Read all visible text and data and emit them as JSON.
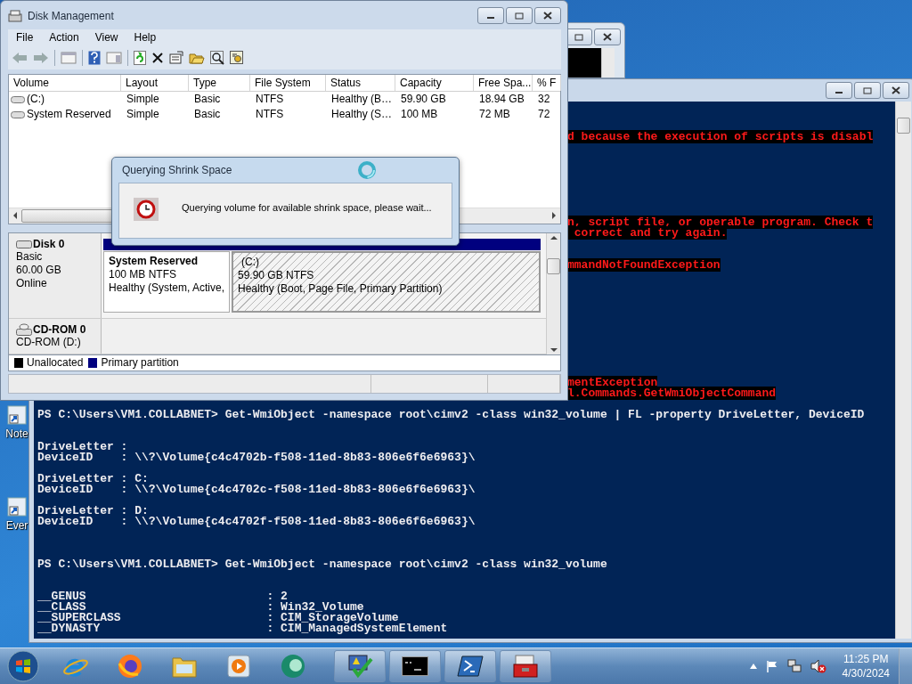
{
  "desktop_icons": [
    {
      "label": "Note"
    },
    {
      "label": "Ever"
    }
  ],
  "console": {
    "blocks": [
      {
        "kind": "error",
        "lines": [
          "d because the execution of scripts is disabl"
        ]
      },
      {
        "kind": "error",
        "lines": [
          "n, script file, or operable program. Check t",
          " correct and try again."
        ]
      },
      {
        "kind": "error",
        "lines": [
          "mmandNotFoundException"
        ]
      },
      {
        "kind": "error",
        "lines": [
          "mentException",
          "l.Commands.GetWmiObjectCommand"
        ]
      },
      {
        "kind": "output",
        "lines": [
          "PS C:\\Users\\VM1.COLLABNET> Get-WmiObject -namespace root\\cimv2 -class win32_volume | FL -property DriveLetter, DeviceID"
        ]
      },
      {
        "kind": "output",
        "lines": [
          "DriveLetter :",
          "DeviceID    : \\\\?\\Volume{c4c4702b-f508-11ed-8b83-806e6f6e6963}\\"
        ]
      },
      {
        "kind": "output",
        "lines": [
          "DriveLetter : C:",
          "DeviceID    : \\\\?\\Volume{c4c4702c-f508-11ed-8b83-806e6f6e6963}\\"
        ]
      },
      {
        "kind": "output",
        "lines": [
          "DriveLetter : D:",
          "DeviceID    : \\\\?\\Volume{c4c4702f-f508-11ed-8b83-806e6f6e6963}\\"
        ]
      },
      {
        "kind": "output",
        "lines": [
          "PS C:\\Users\\VM1.COLLABNET> Get-WmiObject -namespace root\\cimv2 -class win32_volume"
        ]
      },
      {
        "kind": "output",
        "lines": [
          "__GENUS                          : 2",
          "__CLASS                          : Win32_Volume",
          "__SUPERCLASS                     : CIM_StorageVolume",
          "__DYNASTY                        : CIM_ManagedSystemElement"
        ]
      }
    ]
  },
  "disk_management": {
    "title": "Disk Management",
    "menu": [
      "File",
      "Action",
      "View",
      "Help"
    ],
    "columns": [
      "Volume",
      "Layout",
      "Type",
      "File System",
      "Status",
      "Capacity",
      "Free Spa...",
      "% F"
    ],
    "rows": [
      [
        "(C:)",
        "Simple",
        "Basic",
        "NTFS",
        "Healthy (B…",
        "59.90 GB",
        "18.94 GB",
        "32"
      ],
      [
        "System Reserved",
        "Simple",
        "Basic",
        "NTFS",
        "Healthy (S…",
        "100 MB",
        "72 MB",
        "72"
      ]
    ],
    "disks": [
      {
        "kind": "disk",
        "name": "Disk 0",
        "lines": [
          "Basic",
          "60.00 GB",
          "Online"
        ],
        "partitions": [
          {
            "name": "System Reserved",
            "size": "100 MB NTFS",
            "status": "Healthy (System, Active,",
            "selected": false
          },
          {
            "name": "(C:)",
            "size": "59.90 GB NTFS",
            "status": "Healthy (Boot, Page File, Primary Partition)",
            "selected": true
          }
        ]
      },
      {
        "kind": "cdrom",
        "name": "CD-ROM 0",
        "lines": [
          "CD-ROM (D:)"
        ]
      }
    ],
    "legend": [
      {
        "label": "Unallocated",
        "color": "#000000"
      },
      {
        "label": "Primary partition",
        "color": "#00007f"
      }
    ]
  },
  "dialog": {
    "title": "Querying Shrink Space",
    "message": "Querying volume for available shrink space, please wait..."
  },
  "taskbar": {
    "time": "11:25 PM",
    "date": "4/30/2024"
  }
}
